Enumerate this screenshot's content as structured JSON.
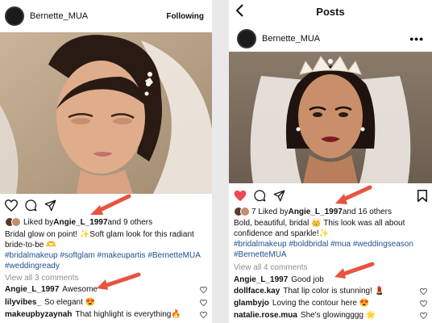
{
  "left_post": {
    "username": "Bernette_MUA",
    "follow_label": "Following",
    "liked_prefix": "Liked by ",
    "liked_user": "Angie_L_1997",
    "liked_suffix": " and 9 others",
    "caption_user": "Bridal",
    "caption_text": " glow on point! ✨Soft glam look for this radiant bride-to-be 🫶",
    "hashtags": "#bridalmakeup #softglam #makeupartis #BernetteMUA #weddingready",
    "view_all": "View all 3 comments",
    "comments": [
      {
        "user": "Angie_L_1997",
        "text": " Awesome"
      },
      {
        "user": "lilyvibes_",
        "text": " So elegant 😍"
      },
      {
        "user": "makeupbyzaynah",
        "text": " That highlight is everything🔥"
      }
    ]
  },
  "right_post": {
    "screen_title": "Posts",
    "username": "Bernette_MUA",
    "more_label": "•••",
    "liked_prefix": "7 Liked by ",
    "liked_user": "Angie_L_1997",
    "liked_suffix": " and 16 others",
    "caption_user": "Bold,",
    "caption_text": " beautiful, bridal 👑 This look was all about confidence and sparkle!✨",
    "hashtags": "#bridalmakeup #boldbridal #mua #weddingseason #BernetteMUA",
    "view_all": "View all 4 comments",
    "comments": [
      {
        "user": "Angie_L_1997",
        "text": " Good job"
      },
      {
        "user": "dollface.kay",
        "text": " That lip color is stunning! 💄"
      },
      {
        "user": "glambyjo",
        "text": " Loving the contour here 😍"
      },
      {
        "user": "natalie.rose.mua",
        "text": " She's glowingggg 🌟"
      }
    ]
  },
  "colors": {
    "annotation_arrow": "#e8533f",
    "like_red": "#ed4956",
    "hashtag_blue": "#1f4f8f"
  },
  "icons": [
    "heart-icon",
    "comment-icon",
    "share-icon",
    "bookmark-icon",
    "back-chevron-icon"
  ]
}
